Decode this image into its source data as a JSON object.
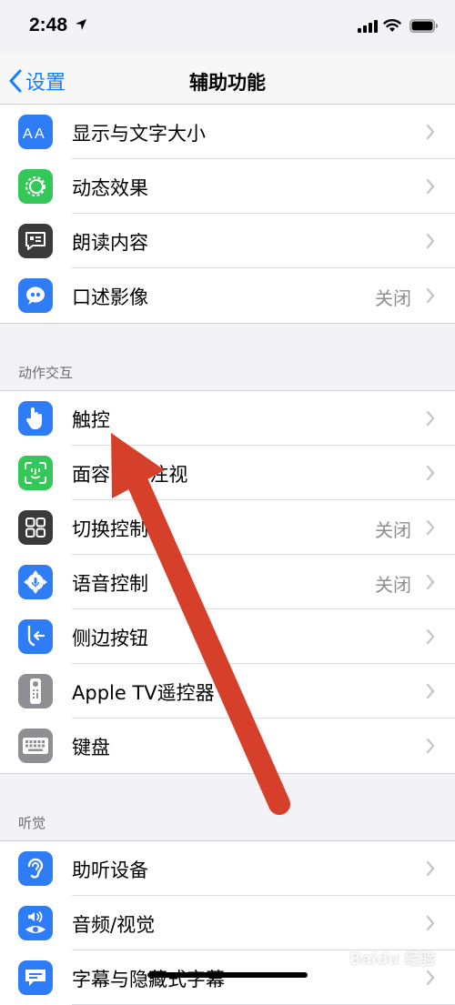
{
  "status": {
    "time": "2:48"
  },
  "nav": {
    "back_label": "设置",
    "title": "辅助功能"
  },
  "vision_items": [
    {
      "label": "显示与文字大小",
      "value": "",
      "icon": "text-size-icon",
      "color": "#2e7cf6"
    },
    {
      "label": "动态效果",
      "value": "",
      "icon": "motion-icon",
      "color": "#34c759"
    },
    {
      "label": "朗读内容",
      "value": "",
      "icon": "spoken-content-icon",
      "color": "#3a3a3c"
    },
    {
      "label": "口述影像",
      "value": "关闭",
      "icon": "audio-description-icon",
      "color": "#2e7cf6"
    }
  ],
  "section_interaction": "动作交互",
  "interaction_items": [
    {
      "label": "触控",
      "value": "",
      "icon": "touch-hand-icon",
      "color": "#2e7cf6"
    },
    {
      "label": "面容ID与注视",
      "value": "",
      "icon": "face-id-icon",
      "color": "#34c759"
    },
    {
      "label": "切换控制",
      "value": "关闭",
      "icon": "switch-control-icon",
      "color": "#3a3a3c"
    },
    {
      "label": "语音控制",
      "value": "关闭",
      "icon": "voice-control-icon",
      "color": "#2e7cf6"
    },
    {
      "label": "侧边按钮",
      "value": "",
      "icon": "side-button-icon",
      "color": "#2e7cf6"
    },
    {
      "label": "Apple TV遥控器",
      "value": "",
      "icon": "tv-remote-icon",
      "color": "#8e8e93"
    },
    {
      "label": "键盘",
      "value": "",
      "icon": "keyboard-icon",
      "color": "#8e8e93"
    }
  ],
  "section_hearing": "听觉",
  "hearing_items": [
    {
      "label": "助听设备",
      "value": "",
      "icon": "hearing-device-icon",
      "color": "#2e7cf6"
    },
    {
      "label": "音频/视觉",
      "value": "",
      "icon": "audio-visual-icon",
      "color": "#2e7cf6"
    },
    {
      "label": "字幕与隐藏式字幕",
      "value": "",
      "icon": "subtitles-icon",
      "color": "#2e7cf6"
    }
  ],
  "watermark": "Baidu 经验",
  "annotation_color": "#d6402b"
}
